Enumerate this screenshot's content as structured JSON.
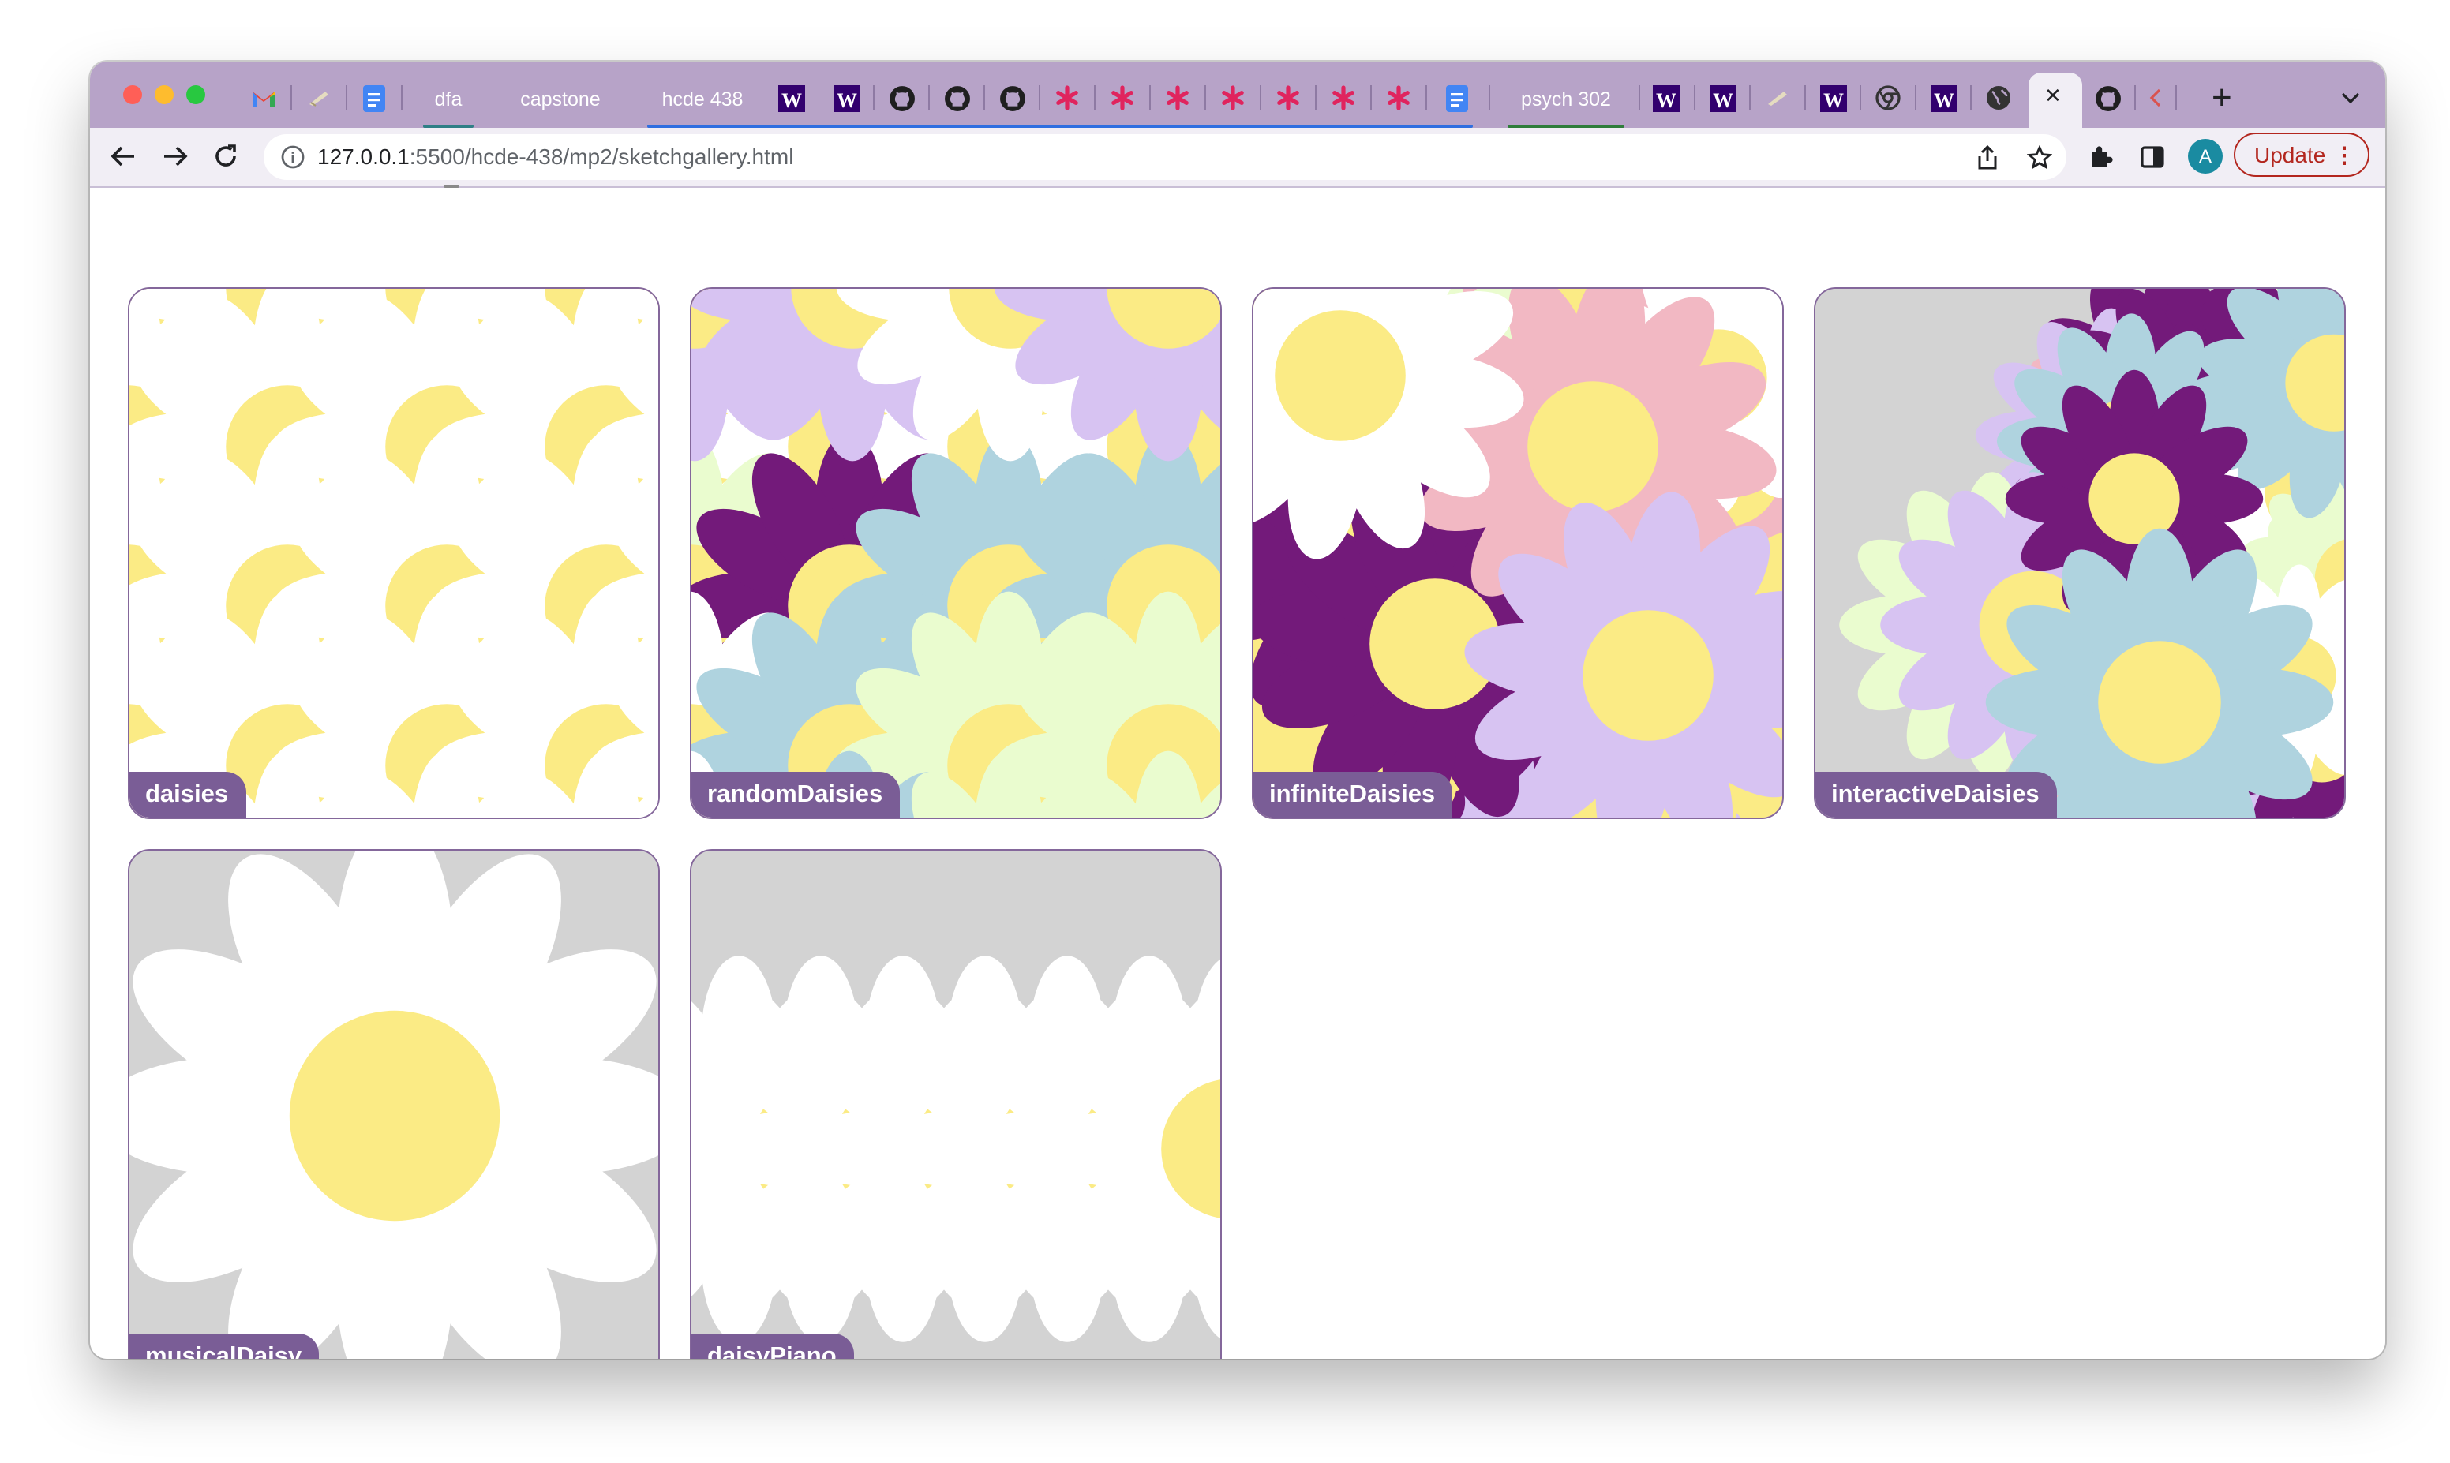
{
  "browser": {
    "tab_groups": [
      {
        "label": "dfa",
        "color": "#2f7f86"
      },
      {
        "label": "capstone",
        "color": "#9146d9"
      },
      {
        "label": "hcde 438",
        "color": "#2f6ee0"
      },
      {
        "label": "psych 302",
        "color": "#2f7d3b"
      }
    ],
    "address_host": "127.0.0.1",
    "address_path": ":5500/hcde-438/mp2/sketchgallery.html",
    "update_label": "Update",
    "menu_glyph": "⋮",
    "avatar_initial": "A",
    "new_tab_glyph": "+",
    "close_glyph": "✕"
  },
  "colors": {
    "frame": "#b7a3c8",
    "label_bg": "#7a5d96",
    "canvas_bg": "#d3d3d3",
    "petal_white": "#ffffff",
    "center_yellow": "#fbeb85",
    "purple": "#731a7a",
    "blue": "#afd3df",
    "pink": "#f2b8c3",
    "lavender": "#d7c3f2",
    "mint": "#eafccf"
  },
  "gallery": {
    "sketches": [
      {
        "name": "daisies"
      },
      {
        "name": "randomDaisies"
      },
      {
        "name": "infiniteDaisies"
      },
      {
        "name": "interactiveDaisies"
      },
      {
        "name": "musicalDaisy"
      },
      {
        "name": "daisyPiano"
      }
    ]
  }
}
